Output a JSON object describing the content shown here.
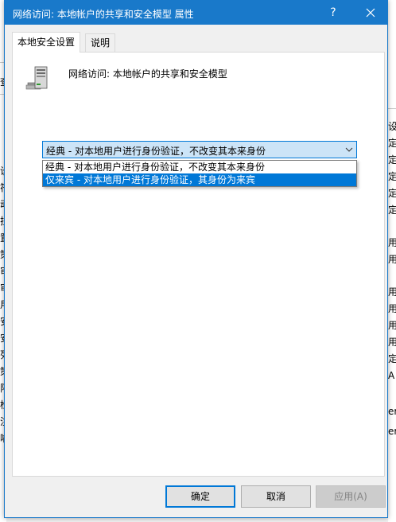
{
  "dialog": {
    "title": "网络访问: 本地帐户的共享和安全模型 属性",
    "help_glyph": "?",
    "tabs": [
      {
        "label": "本地安全设置"
      },
      {
        "label": "说明"
      }
    ],
    "policy_title": "网络访问: 本地帐户的共享和安全模型",
    "combo": {
      "selected": "经典 - 对本地用户进行身份验证，不改变其本来身份",
      "options": [
        "经典 - 对本地用户进行身份验证，不改变其本来身份",
        "仅来宾 - 对本地用户进行身份验证，其身份为来宾"
      ]
    },
    "buttons": {
      "ok": "确定",
      "cancel": "取消",
      "apply": "应用(A)"
    }
  },
  "background": {
    "left_fragments": [
      "查",
      "设",
      "符",
      "动",
      "拉",
      "置",
      "策",
      "审",
      "审",
      "用",
      "安",
      "安",
      "列",
      "策",
      "限",
      "检",
      "注",
      "喻"
    ],
    "right_fragments": [
      "设",
      "定",
      "定",
      "定",
      "定",
      "定",
      "用",
      "用",
      "用",
      "用",
      "用",
      "用",
      "定",
      "A",
      "er",
      "er"
    ]
  },
  "colors": {
    "titlebar": "#1979ca",
    "selection": "#0078d7",
    "combo_focus": "#cce4f7"
  }
}
